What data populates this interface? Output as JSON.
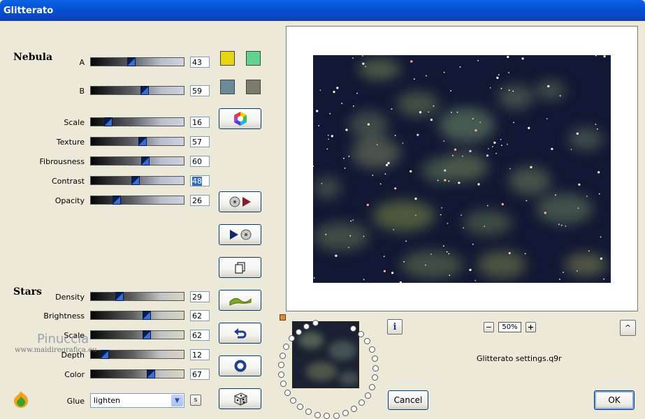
{
  "window": {
    "title": "Glitterato"
  },
  "nebula": {
    "heading": "Nebula",
    "sliders": [
      {
        "label": "A",
        "value": "43",
        "level": 0.43
      },
      {
        "label": "B",
        "value": "59",
        "level": 0.59
      },
      {
        "label": "Scale",
        "value": "16",
        "level": 0.16
      },
      {
        "label": "Texture",
        "value": "57",
        "level": 0.57
      },
      {
        "label": "Fibrousness",
        "value": "60",
        "level": 0.6
      },
      {
        "label": "Contrast",
        "value": "48",
        "level": 0.48
      },
      {
        "label": "Opacity",
        "value": "26",
        "level": 0.26
      }
    ],
    "colors": {
      "a1": "#e5d60f",
      "a2": "#5fd38f",
      "b1": "#6a8a98",
      "b2": "#7b7b6c"
    }
  },
  "stars": {
    "heading": "Stars",
    "sliders": [
      {
        "label": "Density",
        "value": "29",
        "level": 0.29
      },
      {
        "label": "Brightness",
        "value": "62",
        "level": 0.62
      },
      {
        "label": "Scale",
        "value": "62",
        "level": 0.62
      },
      {
        "label": "Depth",
        "value": "12",
        "level": 0.12
      },
      {
        "label": "Color",
        "value": "67",
        "level": 0.67
      }
    ]
  },
  "glue": {
    "label": "Glue",
    "value": "lighten",
    "small_button": "s"
  },
  "watermark": {
    "name": "Pinuccia",
    "url": "www.maidiregrafica.eu"
  },
  "zoom": {
    "value": "50%",
    "minus": "−",
    "plus": "+"
  },
  "settings_file": "Glitterato settings.q9r",
  "buttons": {
    "cancel": "Cancel",
    "ok": "OK",
    "info": "i",
    "up": "^"
  }
}
